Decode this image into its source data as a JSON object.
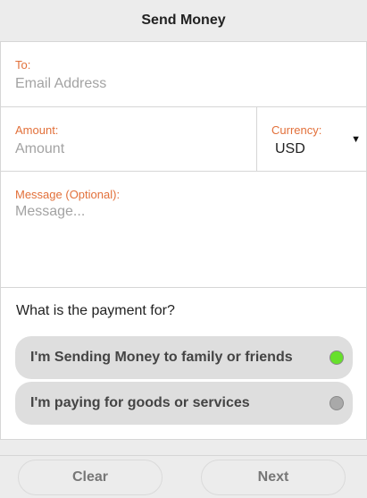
{
  "header": {
    "title": "Send Money"
  },
  "form": {
    "to": {
      "label": "To:",
      "placeholder": "Email Address",
      "value": ""
    },
    "amount": {
      "label": "Amount:",
      "placeholder": "Amount",
      "value": ""
    },
    "currency": {
      "label": "Currency:",
      "selected": "USD"
    },
    "message": {
      "label": "Message (Optional):",
      "placeholder": "Message...",
      "value": ""
    }
  },
  "purpose": {
    "question": "What is the payment for?",
    "options": [
      {
        "label": "I'm Sending Money to family or friends",
        "selected": true,
        "indicator_color": "#66e02b"
      },
      {
        "label": "I'm paying for goods or services",
        "selected": false,
        "indicator_color": "#a9a9a9"
      }
    ]
  },
  "footer": {
    "clear_label": "Clear",
    "next_label": "Next"
  },
  "colors": {
    "label_accent": "#e2703a",
    "background": "#ececec"
  }
}
